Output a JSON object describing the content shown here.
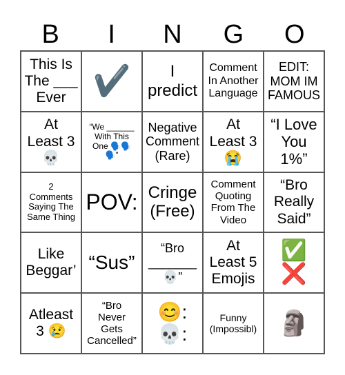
{
  "header": [
    "B",
    "I",
    "N",
    "G",
    "O"
  ],
  "cells": [
    "This Is\nThe ___\nEver",
    "✔️",
    "I\npredict",
    "Comment\nIn Another\nLanguage",
    "EDIT:\nMOM IM\nFAMOUS",
    "At\nLeast 3\n💀",
    "“We ______\nWith This\nOne 🗣️🗣️\n🗣️”",
    "Negative\nComment\n(Rare)",
    "At\nLeast 3\n😭",
    "“I Love\nYou\n1%”",
    "2\nComments\nSaying The\nSame Thing",
    "POV:",
    "Cringe\n(Free)",
    "Comment\nQuoting\nFrom The\nVideo",
    "“Bro\nReally\nSaid”",
    "Like\nBeggar’",
    "“Sus”",
    "“Bro\n_______\n💀”",
    "At\nLeast 5\nEmojis",
    "✅\n❌",
    "Atleast\n3 😢",
    "“Bro\nNever\nGets\nCancelled”",
    "😊:\n💀:",
    "Funny\n(Impossibl)",
    "🗿"
  ]
}
